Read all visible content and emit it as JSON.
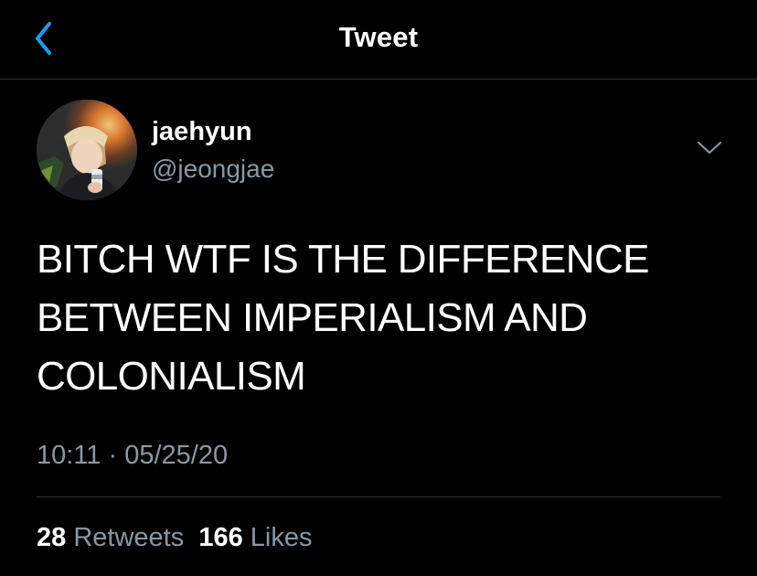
{
  "nav": {
    "title": "Tweet",
    "back_icon": "chevron-left-icon"
  },
  "tweet": {
    "author": {
      "display_name": "jaehyun",
      "handle": "@jeongjae"
    },
    "text_lines": [
      "BITCH WTF IS THE DIFFERENCE",
      "BETWEEN IMPERIALISM AND",
      "COLONIALISM"
    ],
    "time": "10:11",
    "separator": "·",
    "date": "05/25/20",
    "retweets": {
      "count": "28",
      "label": "Retweets"
    },
    "likes": {
      "count": "166",
      "label": "Likes"
    },
    "menu_icon": "chevron-down-icon"
  },
  "colors": {
    "background": "#000000",
    "accent": "#1d9bf0",
    "secondary_text": "#8899a6",
    "divider": "#2f3336"
  }
}
